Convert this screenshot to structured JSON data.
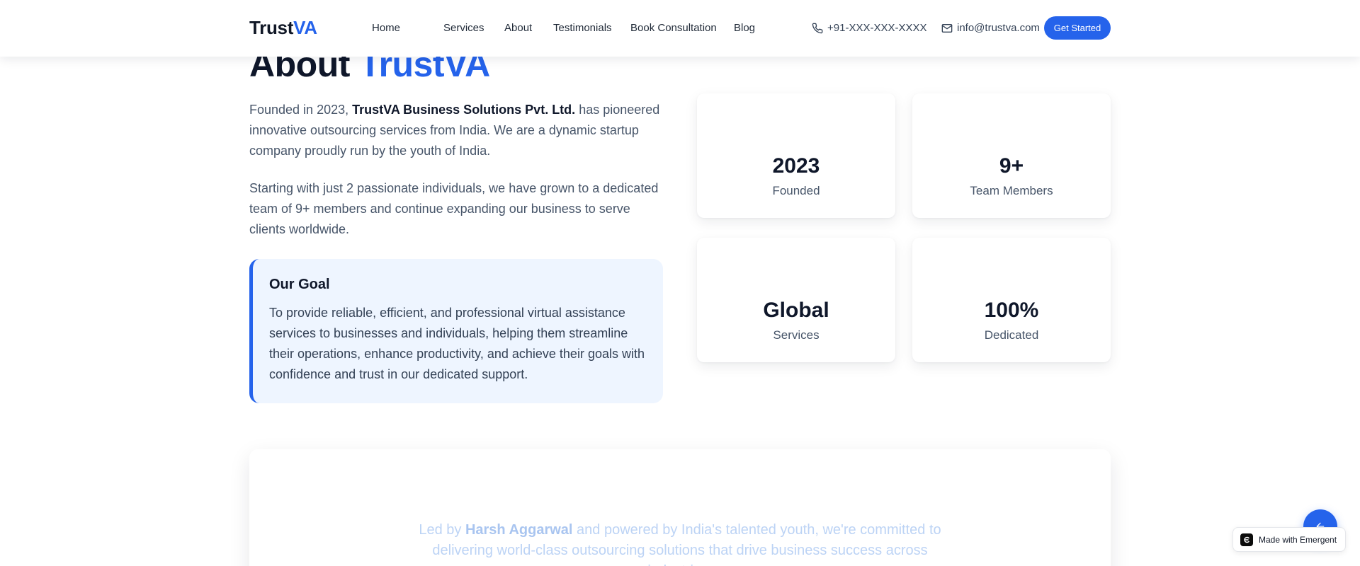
{
  "header": {
    "logo_main": "Trust",
    "logo_accent": "VA",
    "nav": [
      "Home",
      "Services",
      "About",
      "Testimonials",
      "Book Consultation",
      "Blog"
    ],
    "phone": "+91-XXX-XXX-XXXX",
    "email": "info@trustva.com",
    "cta_label": "Get Started",
    "icons": {
      "phone": "phone-icon",
      "email": "mail-icon"
    }
  },
  "about": {
    "title_main": "About",
    "title_accent": "TrustVA",
    "para1_prefix": "Founded in 2023,",
    "para1_company": "TrustVA Business Solutions Pvt. Ltd.",
    "para1_suffix": "has pioneered innovative outsourcing services from India. We are a dynamic startup company proudly run by the youth of India.",
    "para2": "Starting with just 2 passionate individuals, we have grown to a dedicated team of 9+ members and continue expanding our business to serve clients worldwide.",
    "goal": {
      "title": "Our Goal",
      "text": "To provide reliable, efficient, and professional virtual assistance services to businesses and individuals, helping them streamline their operations, enhance productivity, and achieve their goals with confidence and trust in our dedicated support."
    },
    "stats": [
      {
        "value": "2023",
        "label": "Founded"
      },
      {
        "value": "9+",
        "label": "Team Members"
      },
      {
        "value": "Global",
        "label": "Services"
      },
      {
        "value": "100%",
        "label": "Dedicated"
      }
    ]
  },
  "mission": {
    "prefix": "Led by",
    "name": "Harsh Aggarwal",
    "suffix": "and powered by India's talented youth, we're committed to delivering world-class outsourcing solutions that drive business success across industries."
  },
  "floating": {
    "badge_label": "Made with Emergent",
    "fab_icon": "arrow-left-icon"
  },
  "colors": {
    "accent": "#2563eb",
    "goal_bg": "#eef5ff",
    "text_dark": "#0f172a",
    "text_muted": "#475569"
  }
}
